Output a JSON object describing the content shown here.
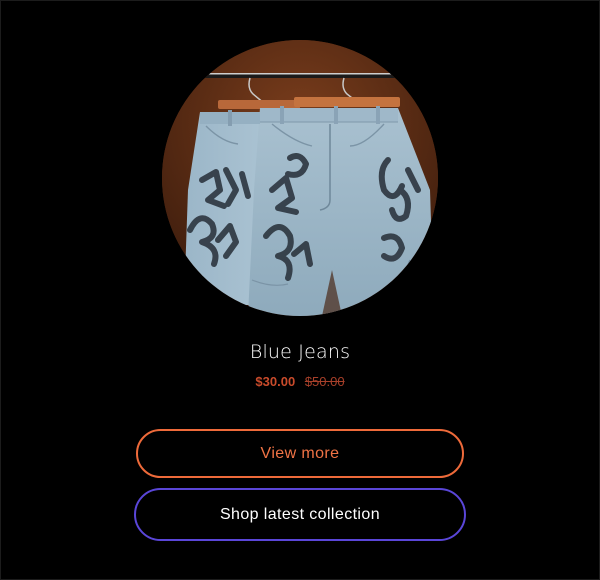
{
  "product": {
    "image_alt": "Blue Jeans",
    "title": "Blue Jeans",
    "price_sale": "$30.00",
    "price_original": "$50.00"
  },
  "actions": {
    "view_more_label": "View more",
    "shop_label": "Shop latest collection"
  },
  "colors": {
    "background": "#000000",
    "price": "#c94b2b",
    "view_more_border": "#ee6a3a",
    "shop_border": "#5a46d8"
  }
}
